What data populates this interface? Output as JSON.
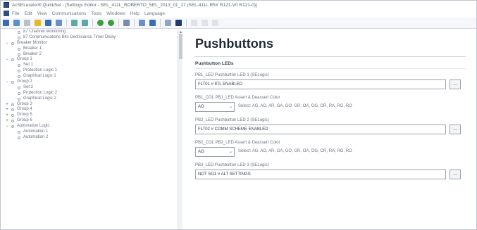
{
  "window": {
    "title": "AcSELerator® QuickSet - [Settings Editor - SEL_411L_ROBERTO_SEL_2013_01_17 (SEL-411L R5X R121-V0 R121-0)]"
  },
  "menu": {
    "items": [
      "File",
      "Edit",
      "View",
      "Communications",
      "Tools",
      "Windows",
      "Help",
      "Language"
    ]
  },
  "toolbar": {
    "icons": [
      "new-icon",
      "open-icon",
      "read-icon",
      "folder-icon",
      "save-icon",
      "print-icon",
      "send-icon",
      "receive-icon",
      "go-back-icon",
      "go-forward-icon",
      "settings-icon",
      "compare-icon",
      "logic-icon",
      "connect-icon",
      "terminal-icon",
      "disabled-icon-1",
      "disabled-icon-2",
      "disabled-icon-3"
    ],
    "colors": {
      "blue": "#3b6db5",
      "green": "#3aa13a",
      "yellow": "#e8b820",
      "grey": "#b9c0c9",
      "red": "#c94040"
    }
  },
  "tree": {
    "items": [
      {
        "label": "87 Channel Monitoring",
        "level": 2,
        "expander": ""
      },
      {
        "label": "87 Communications Bits Dectssance Timer Delay",
        "level": 2,
        "expander": ""
      },
      {
        "label": "Breaker Monitor",
        "level": 1,
        "expander": "−"
      },
      {
        "label": "Breaker 1",
        "level": 2,
        "expander": ""
      },
      {
        "label": "Breaker 2",
        "level": 2,
        "expander": ""
      },
      {
        "label": "Group 1",
        "level": 1,
        "expander": "−"
      },
      {
        "label": "Set 1",
        "level": 2,
        "expander": ""
      },
      {
        "label": "Protection Logic 1",
        "level": 2,
        "expander": ""
      },
      {
        "label": "Graphical Logic 1",
        "level": 2,
        "expander": ""
      },
      {
        "label": "Group 2",
        "level": 1,
        "expander": "−"
      },
      {
        "label": "Set 2",
        "level": 2,
        "expander": ""
      },
      {
        "label": "Protection Logic 2",
        "level": 2,
        "expander": ""
      },
      {
        "label": "Graphical Logic 2",
        "level": 2,
        "expander": ""
      },
      {
        "label": "Group 3",
        "level": 1,
        "expander": "+"
      },
      {
        "label": "Group 4",
        "level": 1,
        "expander": "+"
      },
      {
        "label": "Group 5",
        "level": 1,
        "expander": "+"
      },
      {
        "label": "Group 6",
        "level": 1,
        "expander": "+"
      },
      {
        "label": "Automation Logic",
        "level": 1,
        "expander": "−"
      },
      {
        "label": "Automation 1",
        "level": 2,
        "expander": ""
      },
      {
        "label": "Automation 2",
        "level": 2,
        "expander": ""
      }
    ]
  },
  "panel": {
    "title": "Pushbuttons",
    "section": "Pushbutton LEDs",
    "fields": [
      {
        "label": "PB1_LED  Pushbutton LED 1 (SELogic)",
        "value": "FLT01 # 87L ENABLED",
        "button": "..."
      },
      {
        "label": "PB1_COL  PB1_LED Assert & Deassert Color",
        "combo": "AO",
        "hint": "Select: AG, AO, AR, GA, GO, GR, OA, OG, OR, RA, RG, RO"
      },
      {
        "label": "PB2_LED  Pushbutton LED 2 (SELogic)",
        "value": "FLT02 # COMM SCHEME ENABLED",
        "button": "..."
      },
      {
        "label": "PB2_COL  PB2_LED Assert & Deassert Color",
        "combo": "AO",
        "hint": "Select: AG, AO, AR, GA, GO, GR, OA, OG, OR, RA, RG, RO"
      },
      {
        "label": "PB3_LED  Pushbutton LED 3 (SELogic)",
        "value": "NOT SG1 # ALT SETTINGS",
        "button": "..."
      }
    ]
  }
}
